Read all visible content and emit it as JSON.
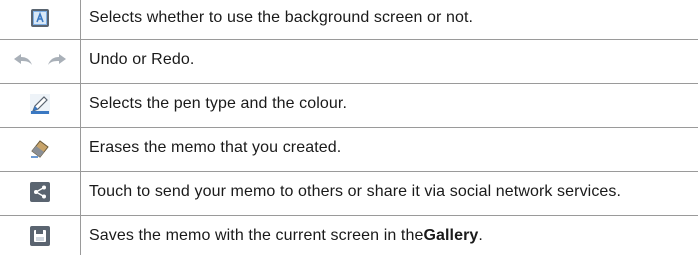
{
  "rows": [
    {
      "icon": "background-screen-icon",
      "text": "Selects whether to use the background screen or not."
    },
    {
      "icon": "undo-redo-icon",
      "text": "Undo or Redo."
    },
    {
      "icon": "pen-icon",
      "text": "Selects the pen type and the colour."
    },
    {
      "icon": "eraser-icon",
      "text": "Erases the memo that you created."
    },
    {
      "icon": "share-icon",
      "text": "Touch to send your memo to others or share it via social network services."
    },
    {
      "icon": "save-icon",
      "text_before": "Saves the memo with the current screen in the ",
      "text_bold": "Gallery",
      "text_after": "."
    }
  ],
  "colors": {
    "rule_line": "#9a9a9a",
    "icon_blue": "#3a78c2",
    "icon_gray": "#5a6470",
    "arrow_gray": "#a9b0b8"
  }
}
